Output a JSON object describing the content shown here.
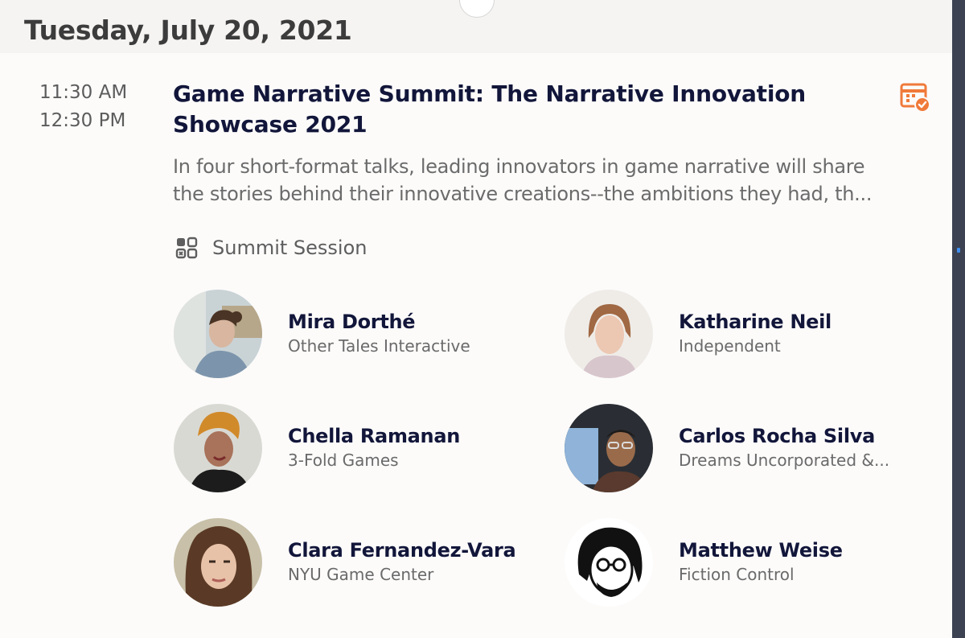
{
  "date_heading": "Tuesday, July 20, 2021",
  "session": {
    "start_time": "11:30 AM",
    "end_time": "12:30 PM",
    "title": "Game Narrative Summit: The Narrative Innovation Showcase 2021",
    "description_lines": [
      "In four short-format talks, leading innovators in game narrative will share",
      "the stories behind their innovative creations--the ambitions they had, th..."
    ],
    "type_label": "Summit Session",
    "type_icon": "grid-apps-icon",
    "calendar_icon": "calendar-check-icon"
  },
  "speakers": [
    {
      "name": "Mira Dorthé",
      "org": "Other Tales Interactive"
    },
    {
      "name": "Katharine Neil",
      "org": "Independent"
    },
    {
      "name": "Chella Ramanan",
      "org": "3-Fold Games"
    },
    {
      "name": "Carlos Rocha Silva",
      "org": "Dreams Uncorporated &..."
    },
    {
      "name": "Clara Fernandez-Vara",
      "org": "NYU Game Center"
    },
    {
      "name": "Matthew Weise",
      "org": "Fiction Control"
    }
  ],
  "colors": {
    "accent": "#f07a3a",
    "title": "#12163a",
    "muted_text": "#6b6b6b",
    "background": "#fcfbfa"
  }
}
